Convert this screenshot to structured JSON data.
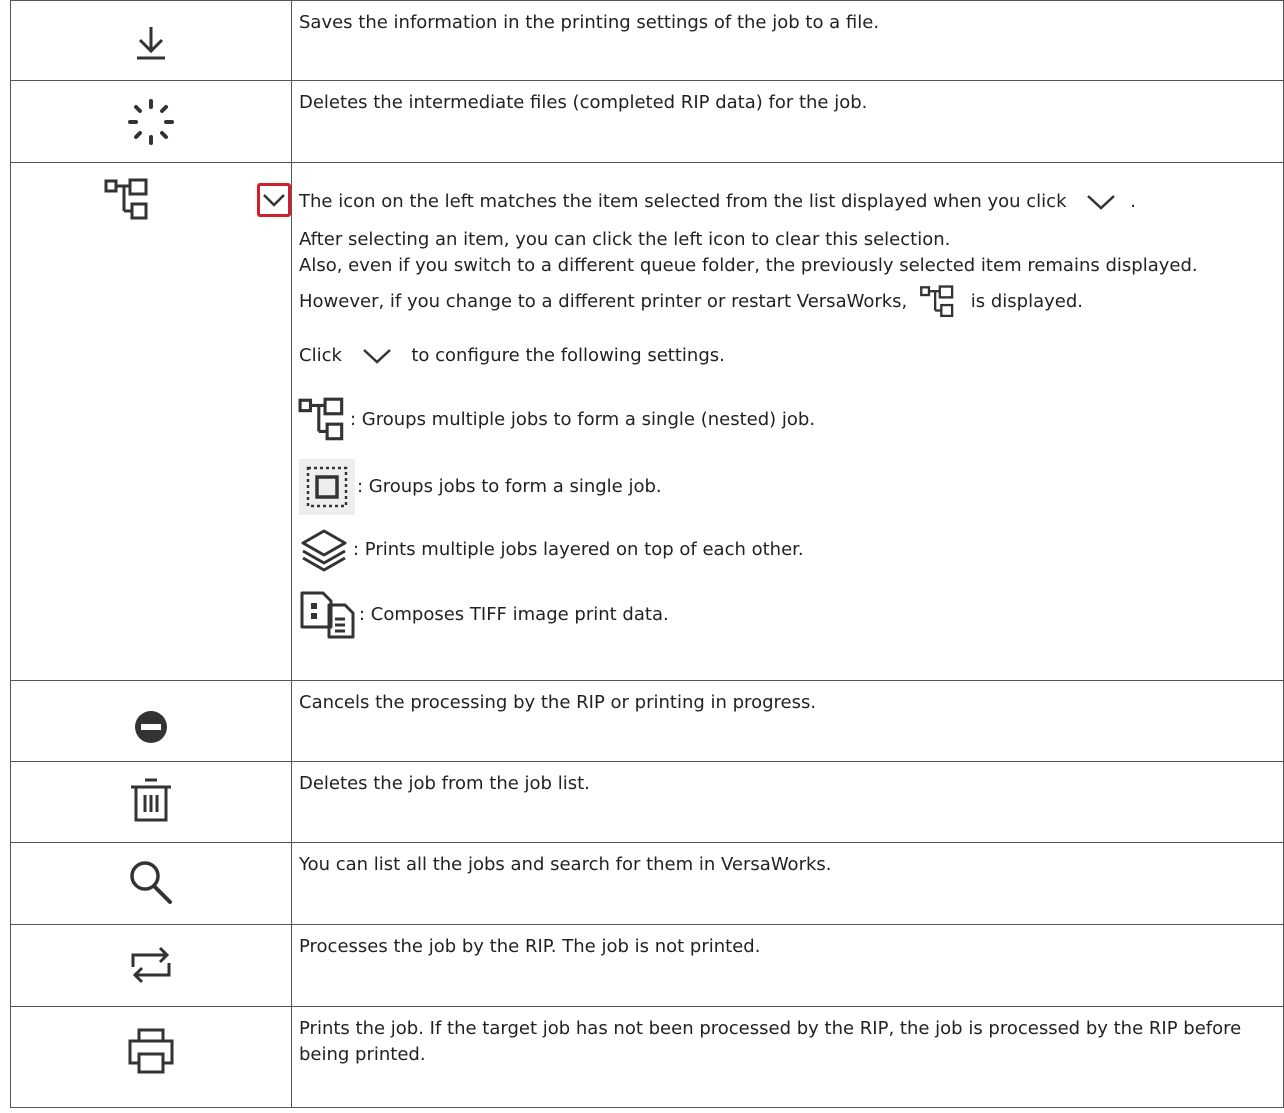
{
  "rows": [
    {
      "icon": "download-icon",
      "text": "Saves the information in the printing settings of the job to a file."
    },
    {
      "icon": "spinner-icon",
      "text": "Deletes the intermediate files (completed RIP data) for the job."
    },
    {
      "icon": "nest-icon",
      "dropdown_icon": "chevron-down-icon",
      "line1_a": "The icon on the left matches the item selected from the list displayed when you click",
      "line1_b": ".",
      "line2": "After selecting an item, you can click the left icon to clear this selection.",
      "line3": "Also, even if you switch to a different queue folder, the previously selected item remains displayed.",
      "line4_a": "However, if you change to a different printer or restart VersaWorks,",
      "line4_b": "is displayed.",
      "line5_a": "Click",
      "line5_b": "to configure the following settings.",
      "settings": [
        {
          "icon": "nest-icon",
          "text": ": Groups multiple jobs to form a single (nested) job."
        },
        {
          "icon": "group-icon",
          "text": ": Groups jobs to form a single job."
        },
        {
          "icon": "layers-icon",
          "text": ": Prints multiple jobs layered on top of each other."
        },
        {
          "icon": "compose-icon",
          "text": ": Composes TIFF image print data."
        }
      ]
    },
    {
      "icon": "cancel-icon",
      "text": "Cancels the processing by the RIP or printing in progress."
    },
    {
      "icon": "trash-icon",
      "text": "Deletes the job from the job list."
    },
    {
      "icon": "search-icon",
      "text": "You can list all the jobs and search for them in VersaWorks."
    },
    {
      "icon": "repeat-icon",
      "text": "Processes the job by the RIP. The job is not printed."
    },
    {
      "icon": "printer-icon",
      "text": "Prints the job. If the target job has not been processed by the RIP, the job is processed by the RIP before being printed."
    }
  ],
  "colors": {
    "accent_red": "#d01f2a",
    "icon": "#333333",
    "border": "#555555"
  }
}
